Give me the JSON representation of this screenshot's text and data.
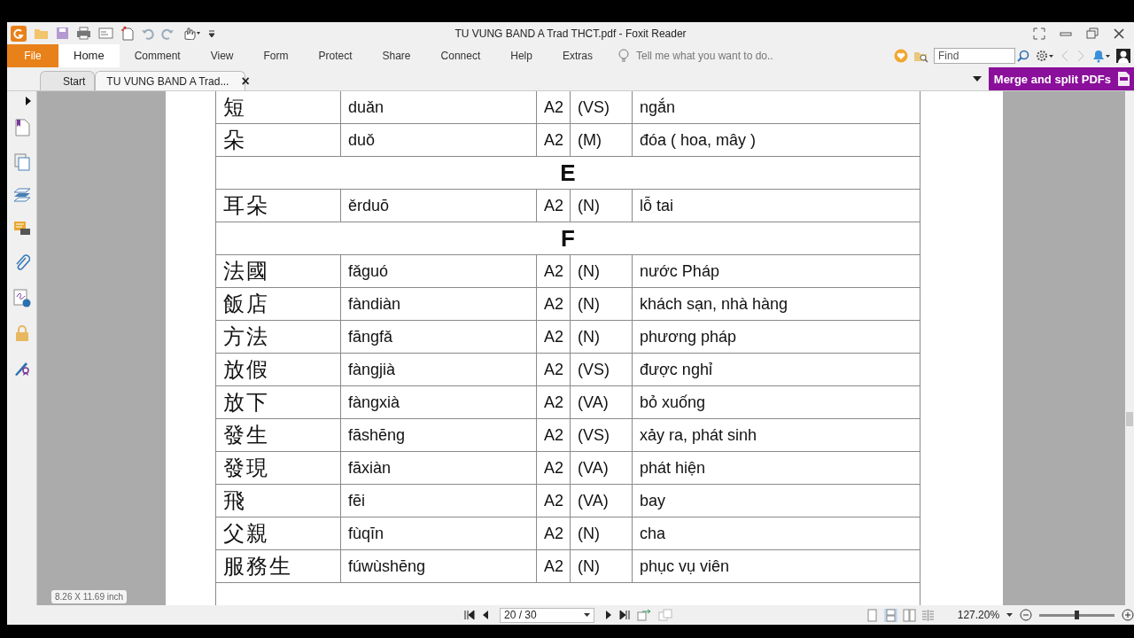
{
  "window": {
    "title": "TU VUNG BAND A Trad THCT.pdf - Foxit Reader"
  },
  "ribbon": {
    "tabs": [
      {
        "label": "File",
        "kind": "file",
        "selected": false
      },
      {
        "label": "Home",
        "kind": "tab",
        "selected": true
      },
      {
        "label": "Comment",
        "kind": "tab",
        "selected": false
      },
      {
        "label": "View",
        "kind": "tab",
        "selected": false
      },
      {
        "label": "Form",
        "kind": "tab",
        "selected": false
      },
      {
        "label": "Protect",
        "kind": "tab",
        "selected": false
      },
      {
        "label": "Share",
        "kind": "tab",
        "selected": false
      },
      {
        "label": "Connect",
        "kind": "tab",
        "selected": false
      },
      {
        "label": "Help",
        "kind": "tab",
        "selected": false
      },
      {
        "label": "Extras",
        "kind": "tab",
        "selected": false
      }
    ],
    "tell_me": {
      "placeholder": "Tell me what you want to do.."
    },
    "find": {
      "placeholder": "Find"
    }
  },
  "doc_tabs": [
    {
      "label": "Start",
      "selected": false
    },
    {
      "label": "TU VUNG BAND A Trad...",
      "selected": true,
      "close": "×"
    }
  ],
  "promo_button": "Merge and split PDFs",
  "table": {
    "rows": [
      {
        "kind": "entry",
        "cells": [
          "短",
          "duǎn",
          "A2",
          "(VS)",
          "ngắn"
        ]
      },
      {
        "kind": "entry",
        "cells": [
          "朵",
          "duǒ",
          "A2",
          "(M)",
          "đóa ( hoa, mây )"
        ]
      },
      {
        "kind": "section",
        "label": "E"
      },
      {
        "kind": "entry",
        "cells": [
          "耳朵",
          "ěrduō",
          "A2",
          "(N)",
          "lỗ tai"
        ]
      },
      {
        "kind": "section",
        "label": "F"
      },
      {
        "kind": "entry",
        "cells": [
          "法國",
          "fǎguó",
          "A2",
          "(N)",
          "nước Pháp"
        ]
      },
      {
        "kind": "entry",
        "cells": [
          "飯店",
          "fàndiàn",
          "A2",
          "(N)",
          "khách sạn, nhà hàng"
        ]
      },
      {
        "kind": "entry",
        "cells": [
          "方法",
          "fāngfǎ",
          "A2",
          "(N)",
          "phương pháp"
        ]
      },
      {
        "kind": "entry",
        "cells": [
          "放假",
          "fàngjià",
          "A2",
          "(VS)",
          "được nghỉ"
        ]
      },
      {
        "kind": "entry",
        "cells": [
          "放下",
          "fàngxià",
          "A2",
          "(VA)",
          "bỏ xuống"
        ]
      },
      {
        "kind": "entry",
        "cells": [
          "發生",
          "fāshēng",
          "A2",
          "(VS)",
          "xảy ra, phát sinh"
        ]
      },
      {
        "kind": "entry",
        "cells": [
          "發現",
          "fāxiàn",
          "A2",
          "(VA)",
          "phát hiện"
        ]
      },
      {
        "kind": "entry",
        "cells": [
          "飛",
          "fēi",
          "A2",
          "(VA)",
          "bay"
        ]
      },
      {
        "kind": "entry",
        "cells": [
          "父親",
          "fùqīn",
          "A2",
          "(N)",
          "cha"
        ]
      },
      {
        "kind": "entry",
        "cells": [
          "服務生",
          "fúwùshēng",
          "A2",
          "(N)",
          "phục vụ viên"
        ]
      }
    ]
  },
  "page_size": "8.26 X 11.69 inch",
  "status_bar": {
    "page": "20 / 30",
    "view_modes": [
      {
        "kind": "single",
        "selected": false
      },
      {
        "kind": "continuous",
        "selected": true
      },
      {
        "kind": "facing",
        "selected": false
      },
      {
        "kind": "cover",
        "selected": false
      }
    ],
    "zoom": "127.20%",
    "zoom_slider": {
      "level": 0.49
    }
  }
}
